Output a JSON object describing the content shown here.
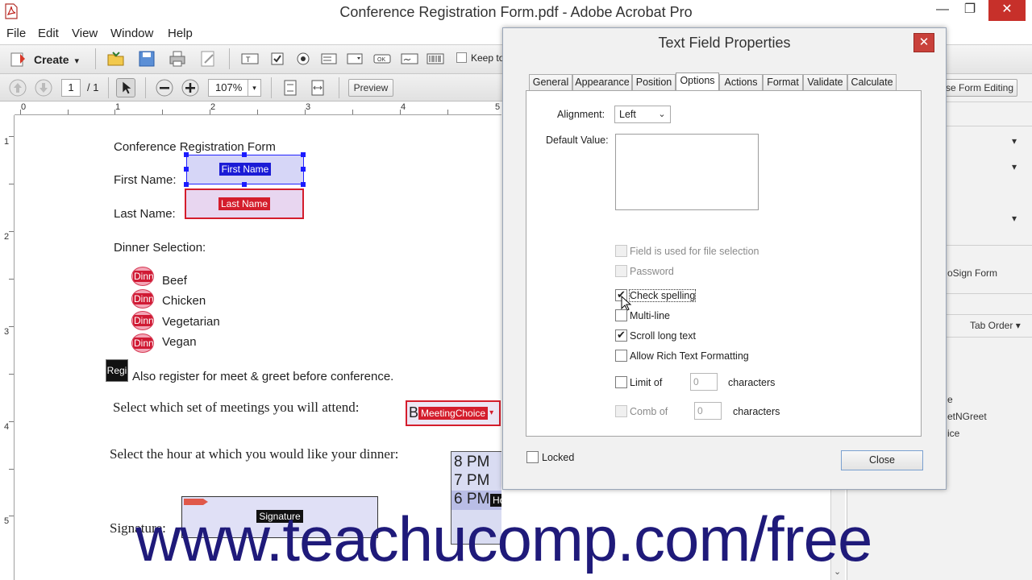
{
  "window": {
    "title": "Conference Registration Form.pdf - Adobe Acrobat Pro",
    "min_glyph": "—",
    "max_glyph": "❐",
    "close_glyph": "✕"
  },
  "menu": [
    "File",
    "Edit",
    "View",
    "Window",
    "Help"
  ],
  "toolbar": {
    "create_label": "Create",
    "create_arrow": "▾",
    "keep_tools_label": "Keep to",
    "page_current": "1",
    "page_count": "/ 1",
    "zoom": "107%",
    "zoom_arrow": "▾",
    "preview_label": "Preview",
    "close_form_editing_label": "se Form Editing"
  },
  "ruler": {
    "h_numbers": [
      "0",
      "1",
      "2",
      "3",
      "4",
      "5"
    ],
    "v_numbers": [
      "1",
      "2",
      "3",
      "4",
      "5"
    ]
  },
  "document": {
    "form_title": "Conference Registration Form",
    "first_name_label": "First Name:",
    "first_name_field": "First Name",
    "last_name_label": "Last Name:",
    "last_name_field": "Last Name",
    "dinner_label": "Dinner Selection:",
    "radio_field_name": "Dinn",
    "dinner_options": [
      "Beef",
      "Chicken",
      "Vegetarian",
      "Vegan"
    ],
    "checkbox_field_name": "Regi",
    "meet_greet_text": "Also register for meet & greet before conference.",
    "meetings_label": "Select which set of meetings you will attend:",
    "meeting_value_prefix": "B",
    "meeting_field": "MeetingChoice",
    "dinner_hour_label": "Select the hour at which you would like your dinner:",
    "hour_options": [
      "8 PM",
      "7 PM",
      "6 PM"
    ],
    "hour_field": "HourChoice",
    "signature_label": "Signature:",
    "signature_field": "Signature"
  },
  "right_pane": {
    "items": [
      "oSign Form",
      "Tab Order",
      "e",
      "etNGreet",
      "ice"
    ],
    "tab_order_arrow": "▾",
    "dropdown_arrow": "▾"
  },
  "dialog": {
    "title": "Text Field Properties",
    "close_glyph": "✕",
    "tabs": [
      "General",
      "Appearance",
      "Position",
      "Options",
      "Actions",
      "Format",
      "Validate",
      "Calculate"
    ],
    "active_tab": "Options",
    "alignment_label": "Alignment:",
    "alignment_value": "Left",
    "alignment_arrow": "⌄",
    "default_value_label": "Default Value:",
    "check_glyph": "✔",
    "options": [
      {
        "label": "Field is used for file selection",
        "checked": false,
        "disabled": true
      },
      {
        "label": "Password",
        "checked": false,
        "disabled": true
      },
      {
        "label": "Check spelling",
        "checked": true,
        "disabled": false
      },
      {
        "label": "Multi-line",
        "checked": false,
        "disabled": false
      },
      {
        "label": "Scroll long text",
        "checked": true,
        "disabled": false
      },
      {
        "label": "Allow Rich Text Formatting",
        "checked": false,
        "disabled": false
      }
    ],
    "limit_of_label": "Limit of",
    "limit_value": "0",
    "limit_unit": "characters",
    "comb_of_label": "Comb of",
    "comb_value": "0",
    "comb_unit": "characters",
    "locked_label": "Locked",
    "close_button": "Close"
  },
  "watermark": "www.teachucomp.com/free",
  "colors": {
    "field_blue": "#1b1bd6",
    "field_red": "#d41d2c",
    "watermark": "#1f1a7a"
  }
}
